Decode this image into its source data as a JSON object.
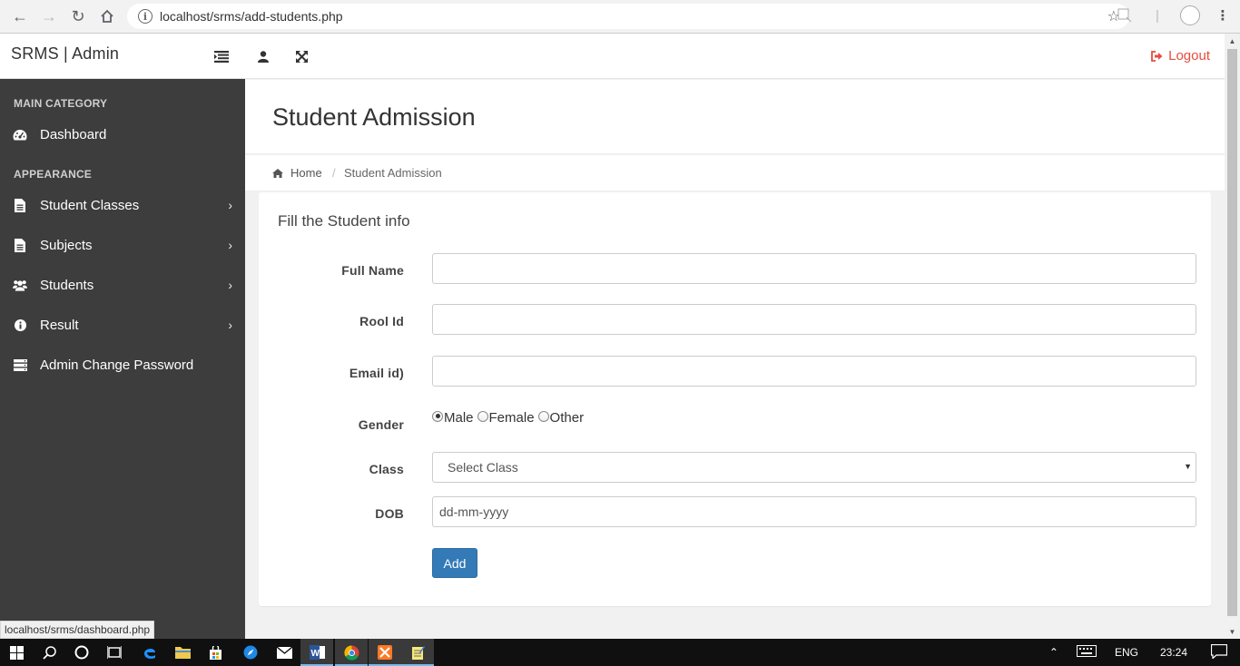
{
  "browser": {
    "url": "localhost/srms/add-students.php",
    "status_url": "localhost/srms/dashboard.php"
  },
  "topbar": {
    "brand": "SRMS | Admin",
    "logout_label": "Logout"
  },
  "sidebar": {
    "main_category": "MAIN CATEGORY",
    "appearance": "APPEARANCE",
    "items": [
      {
        "label": "Dashboard",
        "icon": "dashboard-icon"
      },
      {
        "label": "Student Classes",
        "icon": "file-icon"
      },
      {
        "label": "Subjects",
        "icon": "file-icon"
      },
      {
        "label": "Students",
        "icon": "users-icon"
      },
      {
        "label": "Result",
        "icon": "info-icon"
      },
      {
        "label": "Admin Change Password",
        "icon": "server-icon"
      }
    ]
  },
  "page": {
    "title": "Student Admission",
    "breadcrumb_home": "Home",
    "breadcrumb_current": "Student Admission"
  },
  "form": {
    "heading": "Fill the Student info",
    "full_name_label": "Full Name",
    "roll_id_label": "Rool Id",
    "email_label": "Email id)",
    "gender_label": "Gender",
    "gender_options": [
      "Male",
      "Female",
      "Other"
    ],
    "gender_selected": "Male",
    "class_label": "Class",
    "class_selected": "Select Class",
    "dob_label": "DOB",
    "dob_placeholder": "dd-mm-yyyy",
    "add_label": "Add"
  },
  "taskbar": {
    "language": "ENG",
    "time": "23:24"
  },
  "colors": {
    "sidebar_bg": "#3d3d3d",
    "primary": "#337ab7",
    "logout": "#e74c3c"
  }
}
